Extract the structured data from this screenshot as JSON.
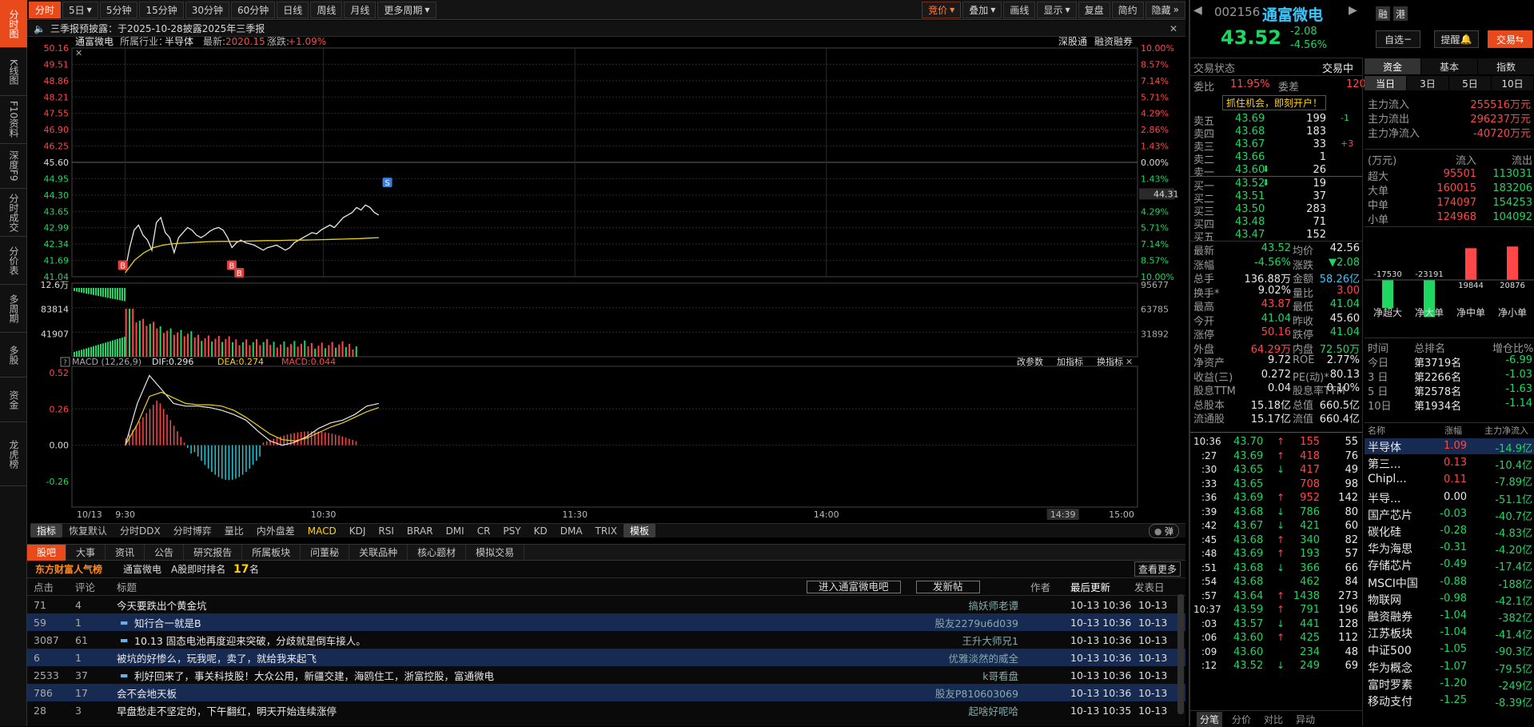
{
  "left_tabs": [
    "分时图",
    "K线图",
    "F10资料",
    "深度F9",
    "分时成交",
    "分价表",
    "多周期",
    "多股",
    "资金",
    "龙虎榜"
  ],
  "toolbar": {
    "items": [
      "分时",
      "5日",
      "5分钟",
      "15分钟",
      "30分钟",
      "60分钟",
      "日线",
      "周线",
      "月线",
      "更多周期"
    ],
    "right_items": [
      "竞价",
      "叠加",
      "画线",
      "显示",
      "复盘",
      "简约",
      "隐藏"
    ]
  },
  "notice": "三季报预披露：于2025-10-28披露2025年三季报",
  "chart_header": {
    "name": "通富微电",
    "industry_label": "所属行业：",
    "industry": "半导体",
    "latest_label": "最新:",
    "latest": "2020.15",
    "change_label": "涨跌:",
    "change": "+1.09%",
    "link1": "深股通",
    "link2": "融资融券"
  },
  "price_axis": {
    "left": [
      "50.16",
      "49.51",
      "48.86",
      "48.21",
      "47.55",
      "46.90",
      "46.25",
      "45.60",
      "44.95",
      "44.30",
      "43.65",
      "42.99",
      "42.34",
      "41.69",
      "41.04"
    ],
    "right": [
      "10.00%",
      "8.57%",
      "7.14%",
      "5.71%",
      "4.29%",
      "2.86%",
      "1.43%",
      "0.00%",
      "1.43%",
      "2.86%",
      "4.29%",
      "5.71%",
      "7.14%",
      "8.57%",
      "10.00%"
    ],
    "current_price_tag": "44.31"
  },
  "volume_axis": {
    "left": [
      "12.6万",
      "83814",
      "41907"
    ],
    "right": [
      "95677",
      "63785",
      "31892"
    ]
  },
  "macd": {
    "label": "MACD (12,26,9)",
    "dif": "DIF:0.296",
    "dea": "DEA:0.274",
    "macd": "MACD:0.044",
    "axis": [
      "0.52",
      "0.26",
      "0.00",
      "-0.26"
    ],
    "links": [
      "改参数",
      "加指标",
      "换指标"
    ]
  },
  "time_axis": [
    "10/13",
    "9:30",
    "10:30",
    "11:30",
    "14:00",
    "14:39",
    "15:00"
  ],
  "markers": [
    "B",
    "B",
    "B",
    "S"
  ],
  "chart_data": {
    "type": "line",
    "x_ticks": [
      "9:30",
      "10:30",
      "11:30",
      "14:00",
      "15:00"
    ],
    "ylim": [
      41.04,
      50.16
    ],
    "prev_close": 45.6,
    "price": [
      41.3,
      42.2,
      42.9,
      43.1,
      42.7,
      42.5,
      42.1,
      43.2,
      43.4,
      42.8,
      42.6,
      42.0,
      42.6,
      42.8,
      43.0,
      42.9,
      42.7,
      42.6,
      42.7,
      42.85,
      42.95,
      43.0,
      42.9,
      42.6,
      42.2,
      42.4,
      42.5,
      42.4,
      42.35,
      42.3,
      42.2,
      42.1,
      42.2,
      42.25,
      42.3,
      42.2,
      42.1,
      42.2,
      42.4,
      42.5,
      42.6,
      42.7,
      42.8,
      42.75,
      42.9,
      43.0,
      43.1,
      43.0,
      43.2,
      43.4,
      43.5,
      43.6,
      43.8,
      43.7,
      43.9,
      43.8,
      43.6,
      43.5
    ],
    "avg": [
      41.2,
      41.7,
      42.0,
      42.2,
      42.3,
      42.35,
      42.38,
      42.4,
      42.42,
      42.44,
      42.45,
      42.45,
      42.45,
      42.46,
      42.47,
      42.48,
      42.48,
      42.49,
      42.5,
      42.5,
      42.51,
      42.52,
      42.53,
      42.54,
      42.55,
      42.56,
      42.58,
      42.6
    ]
  },
  "order_book": {
    "status_label": "交易状态",
    "status": "交易中",
    "ratio_label": "委比",
    "ratio": "11.95%",
    "diff_label": "委差",
    "diff": "120",
    "promo": "抓住机会，即刻开户！",
    "asks": [
      {
        "label": "卖五",
        "price": "43.69",
        "vol": "199",
        "chg": "-1"
      },
      {
        "label": "卖四",
        "price": "43.68",
        "vol": "183",
        "chg": ""
      },
      {
        "label": "卖三",
        "price": "43.67",
        "vol": "33",
        "chg": "+3"
      },
      {
        "label": "卖二",
        "price": "43.66",
        "vol": "1",
        "chg": ""
      },
      {
        "label": "卖一",
        "price": "43.60",
        "vol": "26",
        "chg": ""
      }
    ],
    "bids": [
      {
        "label": "买一",
        "price": "43.52",
        "vol": "19"
      },
      {
        "label": "买二",
        "price": "43.51",
        "vol": "37"
      },
      {
        "label": "买三",
        "price": "43.50",
        "vol": "283"
      },
      {
        "label": "买四",
        "price": "43.48",
        "vol": "71"
      },
      {
        "label": "买五",
        "price": "43.47",
        "vol": "152"
      }
    ]
  },
  "stats": [
    [
      "最新",
      "43.52",
      "均价",
      "42.56"
    ],
    [
      "涨幅",
      "-4.56%",
      "涨跌",
      "▼2.08"
    ],
    [
      "总手",
      "136.88万",
      "金额",
      "58.26亿"
    ],
    [
      "换手*",
      "9.02%",
      "量比",
      "3.00"
    ],
    [
      "最高",
      "43.87",
      "最低",
      "41.04"
    ],
    [
      "今开",
      "41.04",
      "昨收",
      "45.60"
    ],
    [
      "涨停",
      "50.16",
      "跌停",
      "41.04"
    ],
    [
      "外盘",
      "64.29万",
      "内盘",
      "72.50万"
    ],
    [
      "净资产",
      "9.72",
      "ROE",
      "2.77%"
    ],
    [
      "收益(三)",
      "0.272",
      "PE(动)*",
      "80.13"
    ],
    [
      "股息TTM",
      "0.04",
      "股息率TTM",
      "0.10%"
    ],
    [
      "总股本",
      "15.18亿",
      "总值",
      "660.5亿"
    ],
    [
      "流通股",
      "15.17亿",
      "流值",
      "660.4亿"
    ]
  ],
  "ticks": [
    [
      "10:36",
      "43.70",
      "155",
      "55"
    ],
    [
      ":27",
      "43.69",
      "418",
      "76"
    ],
    [
      ":30",
      "43.65",
      "417",
      "49"
    ],
    [
      ":33",
      "43.65",
      "708",
      "98"
    ],
    [
      ":36",
      "43.69",
      "952",
      "142"
    ],
    [
      ":39",
      "43.68",
      "786",
      "80"
    ],
    [
      ":42",
      "43.67",
      "421",
      "60"
    ],
    [
      ":45",
      "43.68",
      "340",
      "82"
    ],
    [
      ":48",
      "43.69",
      "193",
      "57"
    ],
    [
      ":51",
      "43.68",
      "366",
      "66"
    ],
    [
      ":54",
      "43.68",
      "462",
      "84"
    ],
    [
      ":57",
      "43.64",
      "1438",
      "273"
    ],
    [
      "10:37",
      "43.59",
      "791",
      "196"
    ],
    [
      ":03",
      "43.57",
      "441",
      "128"
    ],
    [
      ":06",
      "43.60",
      "425",
      "112"
    ],
    [
      ":09",
      "43.60",
      "234",
      "48"
    ],
    [
      ":12",
      "43.52",
      "249",
      "69"
    ]
  ],
  "bottom_tabs": [
    "分笔",
    "分价",
    "对比",
    "异动"
  ],
  "quote": {
    "code": "002156",
    "name": "通富微电",
    "price": "43.52",
    "change": "-2.08",
    "pct": "-4.56%",
    "btn_rong": "融",
    "btn_gang": "港",
    "btn_zixuan": "自选",
    "btn_tixing": "提醒",
    "btn_jiaoyi": "交易"
  },
  "fund_tabs": [
    "资金",
    "基本",
    "指数"
  ],
  "period_tabs": [
    "当日",
    "3日",
    "5日",
    "10日"
  ],
  "fund_main": [
    [
      "主力流入",
      "255516万元"
    ],
    [
      "主力流出",
      "296237万元"
    ],
    [
      "主力净流入",
      "-40720万元"
    ]
  ],
  "fund_table": {
    "head": [
      "(万元)",
      "流入",
      "流出"
    ],
    "rows": [
      [
        "超大",
        "95501",
        "113031"
      ],
      [
        "大单",
        "160015",
        "183206"
      ],
      [
        "中单",
        "174097",
        "154253"
      ],
      [
        "小单",
        "124968",
        "104092"
      ]
    ]
  },
  "fund_chart": {
    "values": [
      -17530,
      -23191,
      19844,
      20876
    ],
    "labels": [
      "净超大",
      "净大单",
      "净中单",
      "净小单"
    ]
  },
  "rank": {
    "head": [
      "时间",
      "总排名",
      "增仓比%"
    ],
    "rows": [
      [
        "今日",
        "第3719名",
        "-6.99"
      ],
      [
        "3 日",
        "第2266名",
        "-1.03"
      ],
      [
        "5 日",
        "第2578名",
        "-1.63"
      ],
      [
        "10日",
        "第1934名",
        "-1.14"
      ]
    ]
  },
  "sectors": {
    "head": [
      "名称",
      "涨幅",
      "主力净流入"
    ],
    "rows": [
      [
        "半导体",
        "1.09",
        "-14.9亿"
      ],
      [
        "第三...",
        "0.13",
        "-10.4亿"
      ],
      [
        "Chipl...",
        "0.11",
        "-7.89亿"
      ],
      [
        "半导...",
        "0.00",
        "-51.1亿"
      ],
      [
        "国产芯片",
        "-0.03",
        "-40.7亿"
      ],
      [
        "碳化硅",
        "-0.28",
        "-4.83亿"
      ],
      [
        "华为海思",
        "-0.31",
        "-4.20亿"
      ],
      [
        "存储芯片",
        "-0.49",
        "-17.4亿"
      ],
      [
        "MSCI中国",
        "-0.88",
        "-188亿"
      ],
      [
        "物联网",
        "-0.98",
        "-42.1亿"
      ],
      [
        "融资融券",
        "-1.04",
        "-382亿"
      ],
      [
        "江苏板块",
        "-1.04",
        "-41.4亿"
      ],
      [
        "中证500",
        "-1.05",
        "-90.3亿"
      ],
      [
        "华为概念",
        "-1.07",
        "-79.5亿"
      ],
      [
        "富时罗素",
        "-1.20",
        "-249亿"
      ],
      [
        "移动支付",
        "-1.25",
        "-8.39亿"
      ]
    ]
  },
  "indicator_tabs": [
    "指标",
    "恢复默认",
    "分时DDX",
    "分时博弈",
    "量比",
    "内外盘差",
    "MACD",
    "KDJ",
    "RSI",
    "BRAR",
    "DMI",
    "CR",
    "PSY",
    "KD",
    "DMA",
    "TRIX",
    "模板"
  ],
  "indicator_toggle": "弹",
  "news": {
    "tabs": [
      "股吧",
      "大事",
      "资讯",
      "公告",
      "研究报告",
      "所属板块",
      "问董秘",
      "关联品种",
      "核心题材",
      "模拟交易"
    ],
    "brand": "东方财富人气榜",
    "stock": "通富微电",
    "rank_label": "A股即时排名",
    "rank": "17",
    "rank_unit": "名",
    "more": "查看更多",
    "head": [
      "点击",
      "评论",
      "标题",
      "作者",
      "最后更新",
      "发表日"
    ],
    "btn_enter": "进入通富微电吧",
    "btn_post": "发新帖",
    "rows": [
      [
        "71",
        "4",
        "今天要跌出个黄金坑",
        "搞妖师老谭",
        "10-13 10:36",
        "10-13"
      ],
      [
        "59",
        "1",
        "知行合一就是B",
        "股友2279u6d039",
        "10-13 10:36",
        "10-13"
      ],
      [
        "3087",
        "61",
        "10.13 固态电池再度迎来突破，分歧就是倒车接人。",
        "王升大师兄1",
        "10-13 10:36",
        "10-13"
      ],
      [
        "6",
        "1",
        "被坑的好惨么，玩我呢，卖了，就给我来起飞",
        "优雅淡然的威全",
        "10-13 10:36",
        "10-13"
      ],
      [
        "2533",
        "37",
        "利好回来了，事关科技股！大众公用，新疆交建，海鸥住工，浙富控股，富通微电",
        "k哥看盘",
        "10-13 10:36",
        "10-13"
      ],
      [
        "786",
        "17",
        "会不会地天板",
        "股友P810603069",
        "10-13 10:36",
        "10-13"
      ],
      [
        "28",
        "3",
        "早盘愁走不坚定的，下午翻红，明天开始连续涨停",
        "起啥好呢哈",
        "10-13 10:35",
        "10-13"
      ]
    ]
  }
}
